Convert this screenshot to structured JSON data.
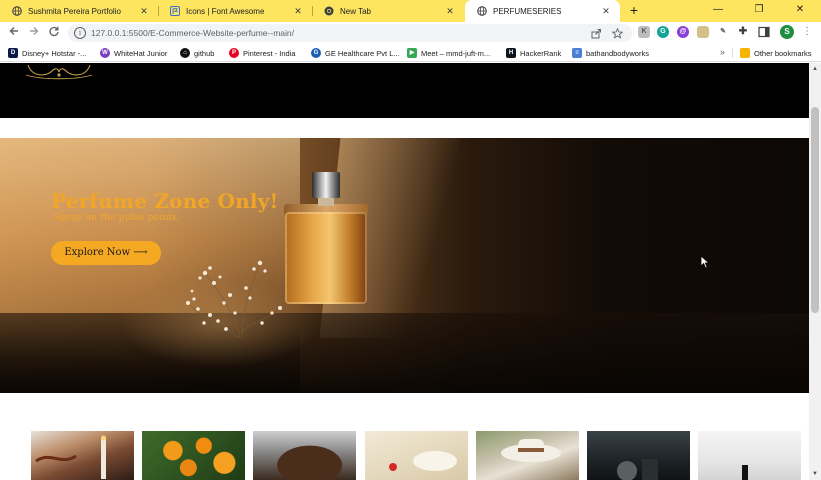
{
  "browser": {
    "tabs": [
      {
        "title": "Sushmita Pereira Portfolio",
        "icon": "globe-icon",
        "active": false
      },
      {
        "title": "Icons | Font Awesome",
        "icon": "flag-icon",
        "active": false
      },
      {
        "title": "New Tab",
        "icon": "chrome-icon",
        "active": false
      },
      {
        "title": "PERFUMESERIES",
        "icon": "globe-icon",
        "active": true
      }
    ],
    "new_tab_label": "+",
    "window_controls": {
      "minimize": "—",
      "restore": "❐",
      "close": "✕"
    },
    "url": "127.0.0.1:5500/E-Commerce-Website-perfume--main/",
    "profile_initial": "S"
  },
  "bookmarks": [
    {
      "label": "Disney+ Hotstar -...",
      "icon": "hotstar-icon",
      "color": "#0c1a4a"
    },
    {
      "label": "WhiteHat Junior",
      "icon": "whitehat-icon",
      "color": "#7b3fbf"
    },
    {
      "label": "github",
      "icon": "github-icon",
      "color": "#111111"
    },
    {
      "label": "Pinterest - India",
      "icon": "pinterest-icon",
      "color": "#e60023"
    },
    {
      "label": "GE Healthcare Pvt L...",
      "icon": "ge-icon",
      "color": "#1a5fb4"
    },
    {
      "label": "Meet – mmd-juft-m...",
      "icon": "meet-icon",
      "color": "#34a853"
    },
    {
      "label": "HackerRank",
      "icon": "hackerrank-icon",
      "color": "#0e141e"
    },
    {
      "label": "bathandbodyworks",
      "icon": "doc-icon",
      "color": "#4a7fd4"
    },
    {
      "label": "Other bookmarks",
      "icon": "folder-icon",
      "color": "#f4b400"
    }
  ],
  "bookmarks_overflow": "»",
  "page": {
    "hero": {
      "title": "Perfume Zone Only!",
      "subtitle": ".Spray on the pulse points.",
      "button_label": "Explore Now ⟶"
    }
  },
  "colors": {
    "tabstrip": "#fde55f",
    "accent": "#f5a822",
    "hero_text": "#f2a628"
  }
}
